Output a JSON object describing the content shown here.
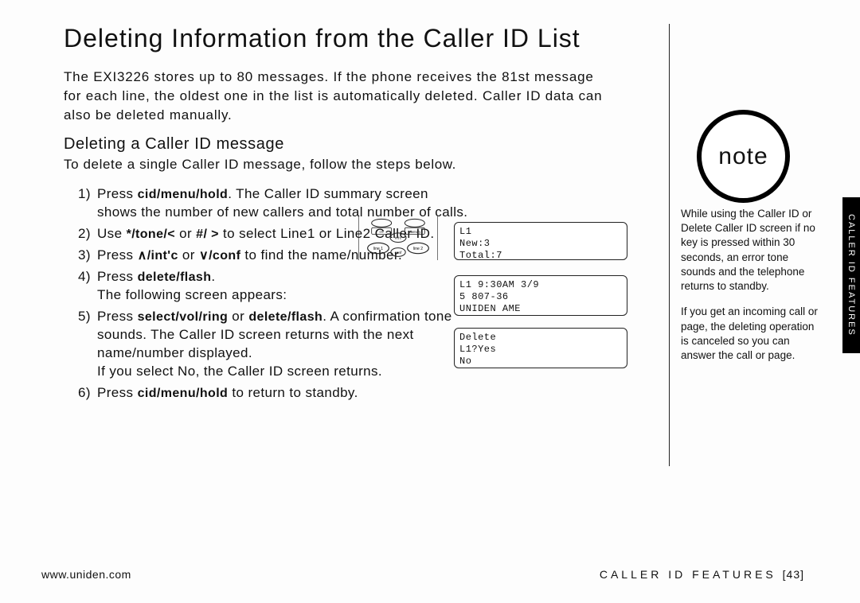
{
  "title": "Deleting Information from the Caller ID List",
  "intro": "The EXI3226 stores up to 80 messages. If the phone receives the 81st message for each line, the oldest one in the list is automatically deleted. Caller ID data can also be deleted manually.",
  "sub_title": "Deleting a Caller ID message",
  "sub_intro": "To delete a single Caller ID message, follow the steps below.",
  "steps": {
    "s1a": "Press ",
    "s1key": "cid/menu/hold",
    "s1b": ". The Caller ID summary screen shows the number of new callers and total number of calls.",
    "s2a": "Use ",
    "s2k1": "*/tone/<",
    "s2mid": " or ",
    "s2k2": "#/ >",
    "s2b": " to select ",
    "s2line1": "Line1",
    "s2or": " or ",
    "s2line2": "Line2",
    "s2c": " Caller ID.",
    "s3a": "Press ",
    "s3k1": "∧/int'c",
    "s3mid": " or ",
    "s3k2": "∨/conf",
    "s3b": " to find the name/number.",
    "s4a": "Press ",
    "s4key": "delete/flash",
    "s4b": ".",
    "s4c": "The following screen appears:",
    "s5a": "Press ",
    "s5k1": "select/vol/ring",
    "s5mid": " or ",
    "s5k2": "delete/flash",
    "s5b": ". A confirmation tone sounds. The Caller ID screen returns with the next name/number displayed.",
    "s5c1": "If you select ",
    "s5no": "No",
    "s5c2": ", the Caller ID screen returns.",
    "s6a": "Press ",
    "s6key": "cid/menu/hold",
    "s6b": " to return to standby."
  },
  "lcd1": {
    "l1": "L1",
    "l2": "New:3",
    "l3": "Total:7"
  },
  "lcd2": {
    "l1": "L1 9:30AM 3/9",
    "l2": "5 807-36",
    "l3": "  UNIDEN AME"
  },
  "lcd3": {
    "l1": "   Delete",
    "l2": "L1?Yes",
    "l3": " No"
  },
  "note_label": "note",
  "note1a": "While using the ",
  "note1k1": "Caller ID",
  "note1b": " or ",
  "note1k2": "Delete Caller ID",
  "note1c": " screen if no key is pressed within 30 seconds, an error tone sounds and the telephone returns to standby.",
  "note2": "If you get an incoming call or page, the deleting operation is canceled so you can answer the call or page.",
  "side_tab": "CALLER ID FEATURES",
  "footer_url": "www.uniden.com",
  "footer_section": "CALLER ID FEATURES",
  "footer_page": "[43]",
  "keypad_labels": {
    "cid": "cid/\nmenu/hold",
    "mem": "memory",
    "line1": "line 1",
    "line2": "line 2",
    "intc": "int'c",
    "conf": "conf"
  }
}
